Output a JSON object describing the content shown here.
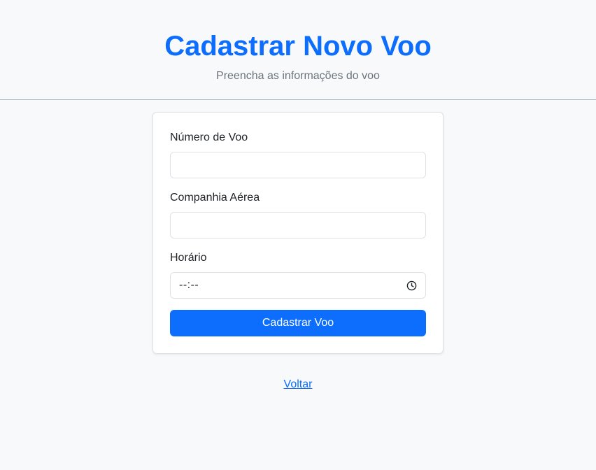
{
  "header": {
    "title": "Cadastrar Novo Voo",
    "subtitle": "Preencha as informações do voo"
  },
  "form": {
    "flight_number": {
      "label": "Número de Voo",
      "value": ""
    },
    "airline": {
      "label": "Companhia Aérea",
      "value": ""
    },
    "time": {
      "label": "Horário",
      "display": "--:--",
      "icon": "clock-icon"
    },
    "submit_label": "Cadastrar Voo"
  },
  "back_link": "Voltar",
  "colors": {
    "primary": "#0d6efd",
    "background": "#f8f9fa",
    "muted": "#6c757d"
  }
}
